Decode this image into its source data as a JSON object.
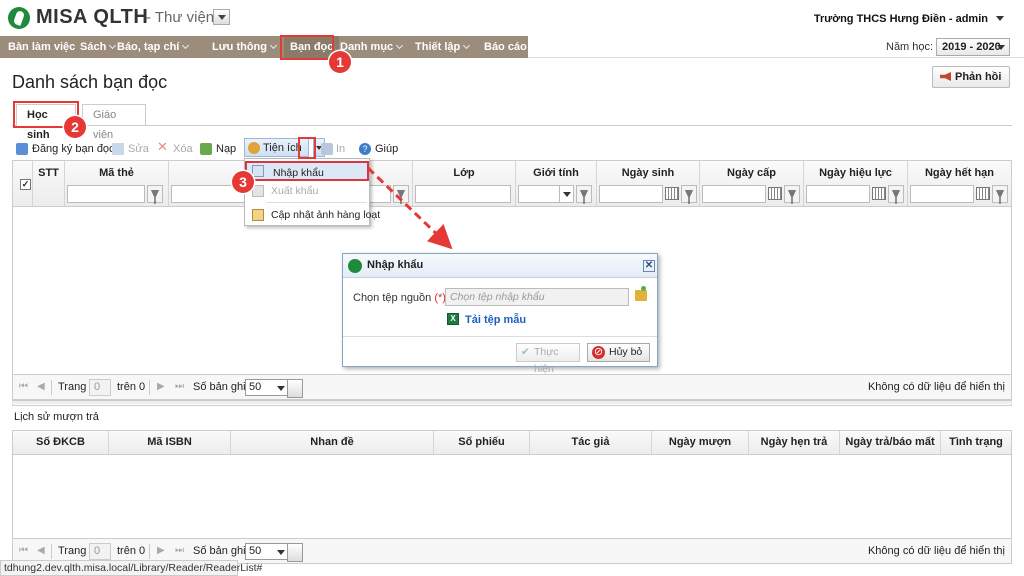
{
  "header": {
    "logo": "MISA QLTH",
    "module": "- Thư viện",
    "user": "Trường THCS Hưng Điền - admin"
  },
  "nav": {
    "items": [
      "Bàn làm việc",
      "Sách",
      "Báo, tạp chí",
      "Lưu thông",
      "Bạn đọc",
      "Danh mục",
      "Thiết lập",
      "Báo cáo"
    ],
    "school_year_label": "Năm học:",
    "school_year": "2019 - 2020"
  },
  "page": {
    "title": "Danh sách bạn đọc",
    "feedback": "Phản hồi",
    "tabs": [
      "Học sinh",
      "Giáo viên"
    ]
  },
  "toolbar": {
    "register": "Đăng ký bạn đọc",
    "edit": "Sửa",
    "delete": "Xóa",
    "reload": "Nạp",
    "utilities": "Tiện ích",
    "print": "In",
    "help": "Giúp"
  },
  "util_menu": {
    "import": "Nhập khẩu",
    "export": "Xuất khẩu",
    "update_photos": "Cập nhật ảnh hàng loạt"
  },
  "reader_grid": {
    "columns": [
      "STT",
      "Mã thẻ",
      "Lớp",
      "Giới tính",
      "Ngày sinh",
      "Ngày cấp",
      "Ngày hiệu lực",
      "Ngày hết hạn"
    ]
  },
  "pager": {
    "page_label": "Trang",
    "page_value": "0",
    "of_label": "trên 0",
    "size_label": "Số bản ghi",
    "size_value": "50",
    "empty": "Không có dữ liệu để hiển thị"
  },
  "history": {
    "title": "Lịch sử mượn trả",
    "columns": [
      "Số ĐKCB",
      "Mã ISBN",
      "Nhan đề",
      "Số phiếu",
      "Tác giả",
      "Ngày mượn",
      "Ngày hẹn trả",
      "Ngày trả/báo mất",
      "Tình trạng"
    ]
  },
  "dialog": {
    "title": "Nhập khẩu",
    "source_label": "Chọn tệp nguồn",
    "required_mark": "(*)",
    "source_placeholder": "Chọn tệp nhập khẩu",
    "template_link": "Tải tệp mẫu",
    "ok": "Thực hiện",
    "cancel": "Hủy bỏ"
  },
  "annotations": [
    "1",
    "2",
    "3"
  ],
  "status_url": "tdhung2.dev.qlth.misa.local/Library/Reader/ReaderList#",
  "colors": {
    "nav_bg": "#9b8c7c",
    "annotation_red": "#e53935",
    "logo_green": "#1e8a3c",
    "link_blue": "#1c5fbf"
  }
}
